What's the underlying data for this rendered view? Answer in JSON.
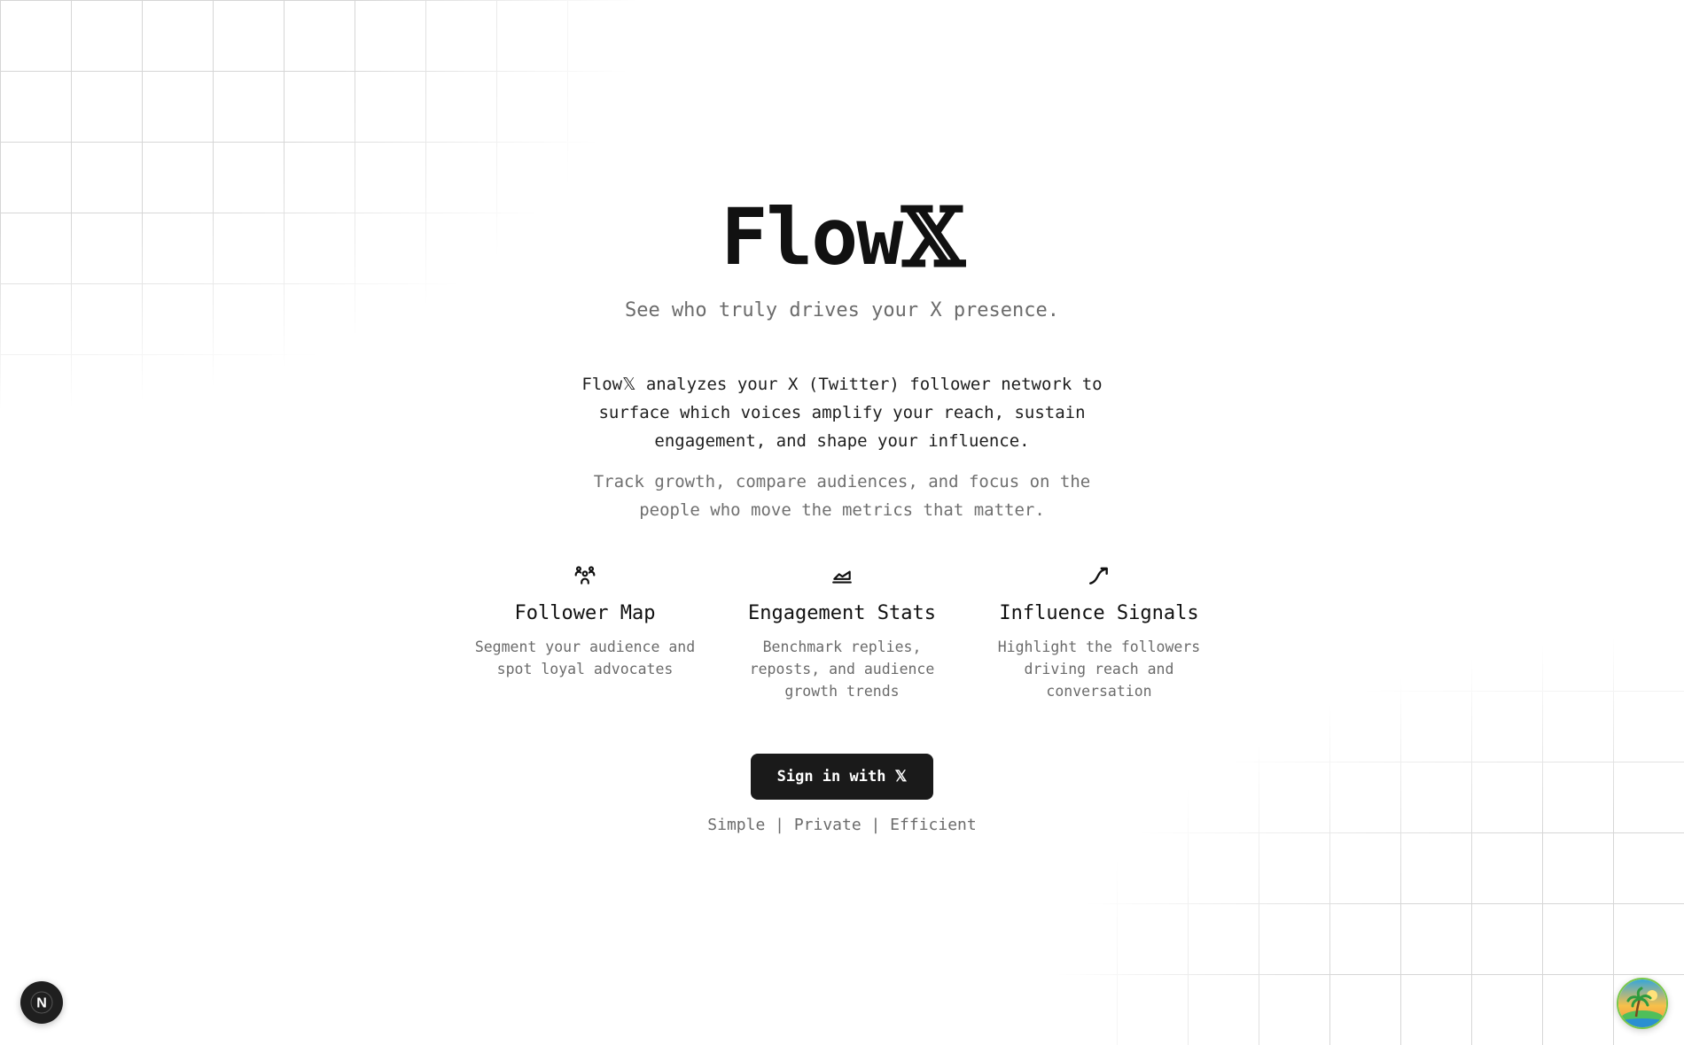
{
  "app": {
    "name_prefix": "Flow",
    "name_suffix": "𝕏",
    "tagline": "See who truly drives your X presence."
  },
  "intro": {
    "description": "Flow𝕏 analyzes your X (Twitter) follower network to surface which voices amplify your reach, sustain engagement, and shape your influence.",
    "secondary": "Track growth, compare audiences, and focus on the people who move the metrics that matter."
  },
  "features": [
    {
      "icon": "users-icon",
      "title": "Follower Map",
      "description": "Segment your audience and spot loyal advocates"
    },
    {
      "icon": "area-chart-icon",
      "title": "Engagement Stats",
      "description": "Benchmark replies, reposts, and audience growth trends"
    },
    {
      "icon": "trending-up-icon",
      "title": "Influence Signals",
      "description": "Highlight the followers driving reach and conversation"
    }
  ],
  "cta": {
    "signin_label": "Sign in with 𝕏"
  },
  "footer": {
    "tagline": "Simple | Private | Efficient"
  },
  "overlays": {
    "dev_badge_letter": "N"
  },
  "colors": {
    "background": "#ffffff",
    "text": "#111111",
    "muted": "#6b6b6b",
    "button": "#1a1a1a",
    "grid": "#d6d6d6"
  }
}
